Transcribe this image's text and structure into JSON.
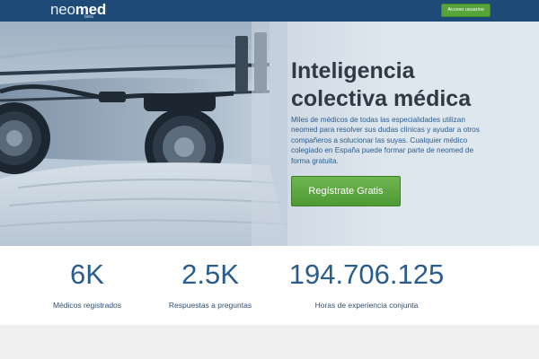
{
  "header": {
    "logo_neo": "neo",
    "logo_med": "med",
    "logo_badge": "beta",
    "login_label": "Acceso usuarios"
  },
  "hero": {
    "title_line1": "Inteligencia",
    "title_line2": "colectiva médica",
    "description": "Miles de médicos de todas las especialidades utilizan neomed para resolver sus dudas clínicas y ayudar a otros compañeros a solucionar las suyas. Cualquier médico colegiado en España puede formar parte de neomed de forma gratuita.",
    "cta_label": "Regístrate Gratis"
  },
  "stats": [
    {
      "value": "6K",
      "label": "Médicos registrados"
    },
    {
      "value": "2.5K",
      "label": "Respuestas a preguntas"
    },
    {
      "value": "194.706.125",
      "label": "Horas de experiencia conjunta"
    }
  ],
  "colors": {
    "header_bg": "#1e4a78",
    "accent_blue": "#2a5d8f",
    "cta_green": "#5aa63d",
    "title_text": "#2f3a44"
  },
  "icons": {
    "hero_image": "surgeon-with-loupes-photo"
  }
}
